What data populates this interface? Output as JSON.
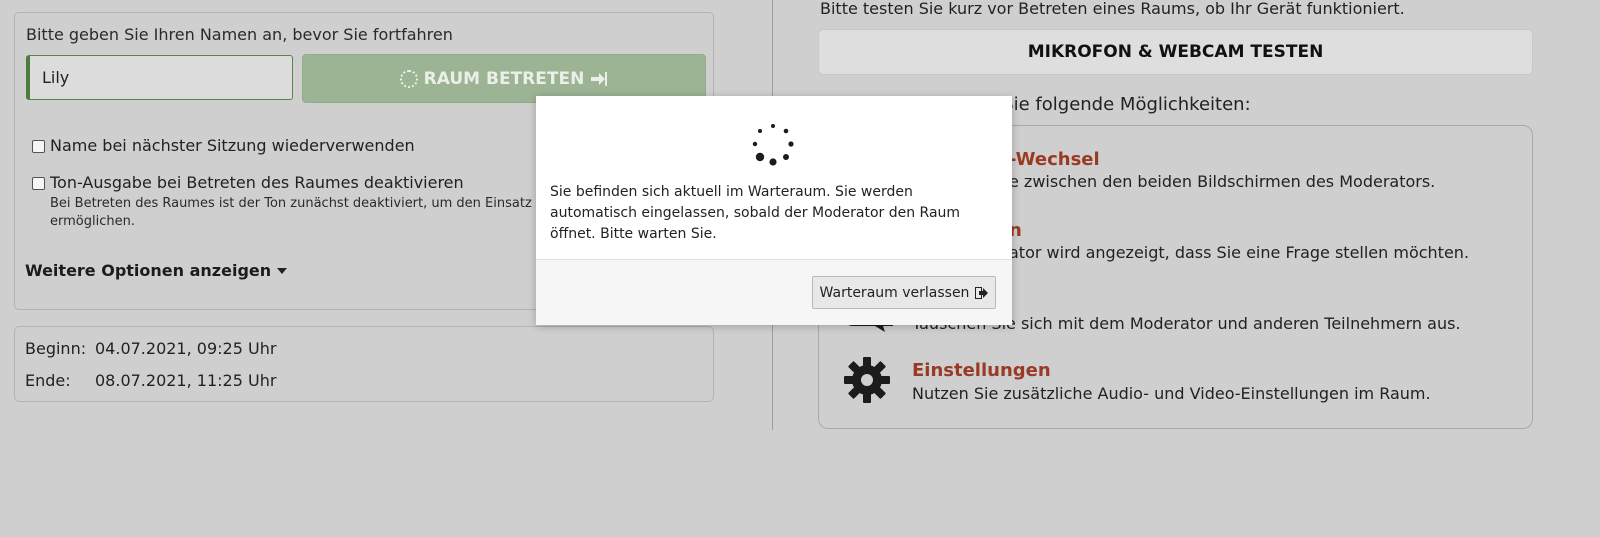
{
  "form": {
    "prompt": "Bitte geben Sie Ihren Namen an, bevor Sie fortfahren",
    "name_value": "Lily",
    "enter_label": "RAUM BETRETEN",
    "reuse_name_label": "Name bei nächster Sitzung wiederverwenden",
    "mute_audio_label": "Ton-Ausgabe bei Betreten des Raumes deaktivieren",
    "mute_hint_line1": "Bei Betreten des Raumes ist der Ton zunächst deaktiviert, um den Einsatz von S",
    "mute_hint_line2": "ermöglichen.",
    "more_options_label": "Weitere Optionen anzeigen"
  },
  "schedule": {
    "start_label": "Beginn:",
    "start_value": "04.07.2021, 09:25 Uhr",
    "end_label": "Ende:",
    "end_value": "08.07.2021, 11:25 Uhr"
  },
  "right": {
    "test_hint": "Bitte testen Sie kurz vor Betreten eines Raums, ob Ihr Gerät funktioniert.",
    "test_button": "MIKROFON & WEBCAM TESTEN",
    "features_heading": "en Sie folgende Möglichkeiten:",
    "features": [
      {
        "title": "-Wechsel",
        "desc": "e zwischen den beiden Bildschirmen des Moderators."
      },
      {
        "title": "n",
        "desc": "ator wird angezeigt, dass Sie eine Frage stellen möchten."
      },
      {
        "title": "",
        "desc": "Tauschen Sie sich mit dem Moderator und anderen Teilnehmern aus."
      },
      {
        "title": "Einstellungen",
        "desc": "Nutzen Sie zusätzliche Audio- und Video-Einstellungen im Raum."
      }
    ]
  },
  "modal": {
    "message": "Sie befinden sich aktuell im Warteraum. Sie werden automatisch eingelassen, sobald der Moderator den Raum öffnet. Bitte warten Sie.",
    "leave_button": "Warteraum verlassen"
  },
  "colors": {
    "accent_green": "#9cb394",
    "feature_title": "#9a3a25",
    "background": "#cfcfcf"
  },
  "icons": {
    "enter": "sign-in-icon",
    "caret": "caret-down-icon",
    "chat": "chat-icon",
    "settings": "gear-icon",
    "spinner": "loading-spinner-icon",
    "leave": "sign-out-icon"
  }
}
